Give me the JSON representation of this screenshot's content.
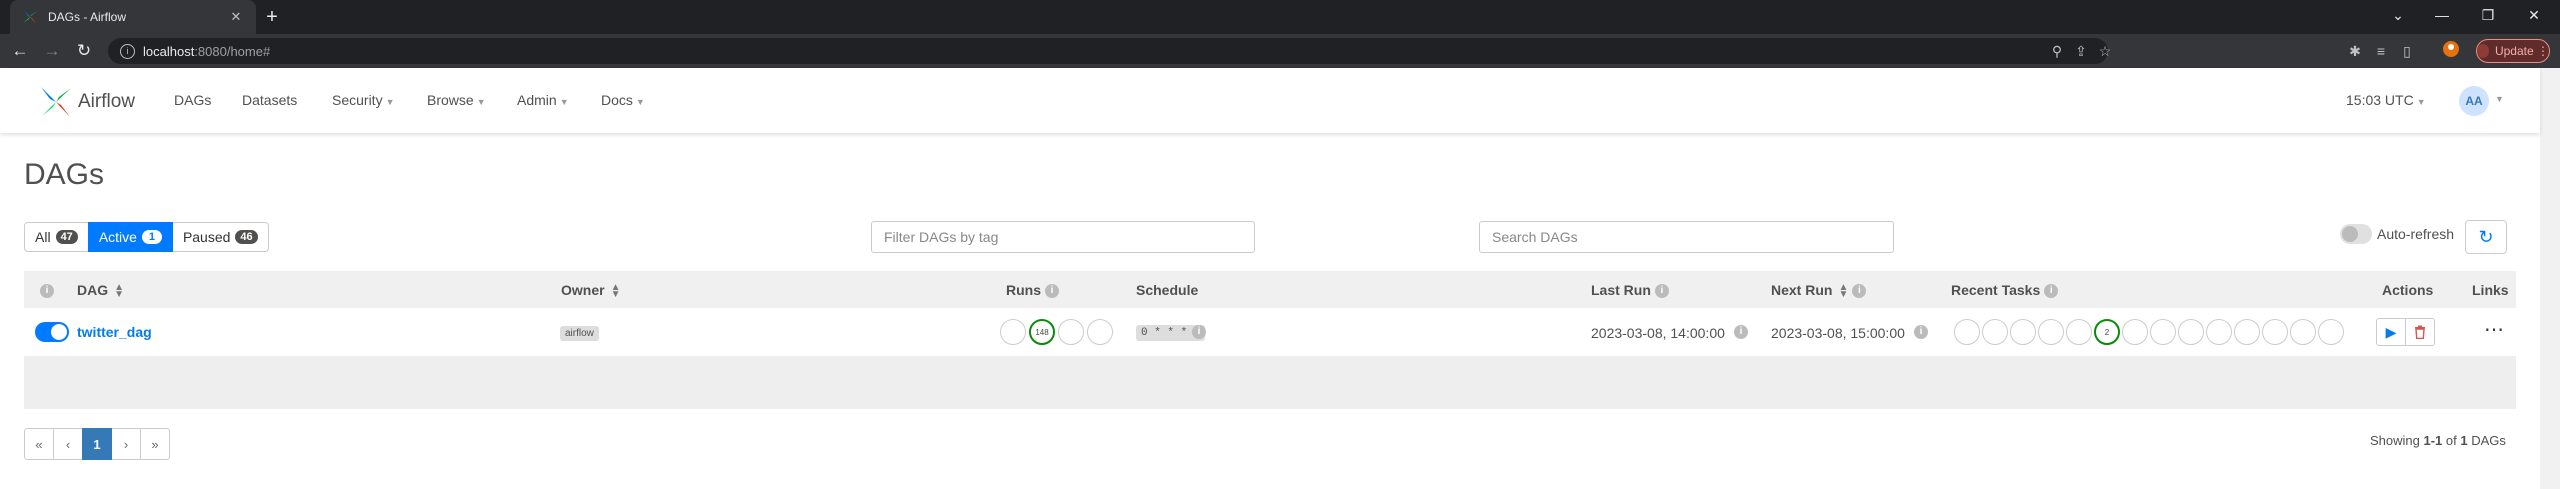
{
  "browser": {
    "tab_title": "DAGs - Airflow",
    "url_host": "localhost",
    "url_rest": ":8080/home#",
    "update_label": "Update"
  },
  "navbar": {
    "brand": "Airflow",
    "items": [
      "DAGs",
      "Datasets",
      "Security",
      "Browse",
      "Admin",
      "Docs"
    ],
    "clock": "15:03 UTC",
    "user_initials": "AA"
  },
  "page_title": "DAGs",
  "status_filters": [
    {
      "label": "All",
      "count": "47"
    },
    {
      "label": "Active",
      "count": "1"
    },
    {
      "label": "Paused",
      "count": "46"
    }
  ],
  "tag_filter_placeholder": "Filter DAGs by tag",
  "search_placeholder": "Search DAGs",
  "auto_refresh_label": "Auto-refresh",
  "columns": {
    "dag": "DAG",
    "owner": "Owner",
    "runs": "Runs",
    "schedule": "Schedule",
    "last_run": "Last Run",
    "next_run": "Next Run",
    "recent_tasks": "Recent Tasks",
    "actions": "Actions",
    "links": "Links"
  },
  "rows": [
    {
      "dag_id": "twitter_dag",
      "owner": "airflow",
      "runs_success": "148",
      "schedule": "0 * * * *",
      "last_run": "2023-03-08, 14:00:00",
      "next_run": "2023-03-08, 15:00:00",
      "recent_success": "2"
    }
  ],
  "pagination": {
    "first": "«",
    "prev": "‹",
    "current": "1",
    "next": "›",
    "last": "»"
  },
  "showing": {
    "prefix": "Showing",
    "range": "1-1",
    "of": "of",
    "total": "1",
    "suffix": "DAGs"
  },
  "colors": {
    "accent": "#007bff",
    "link": "#017cee",
    "success": "#008000",
    "danger": "#d9534f"
  }
}
